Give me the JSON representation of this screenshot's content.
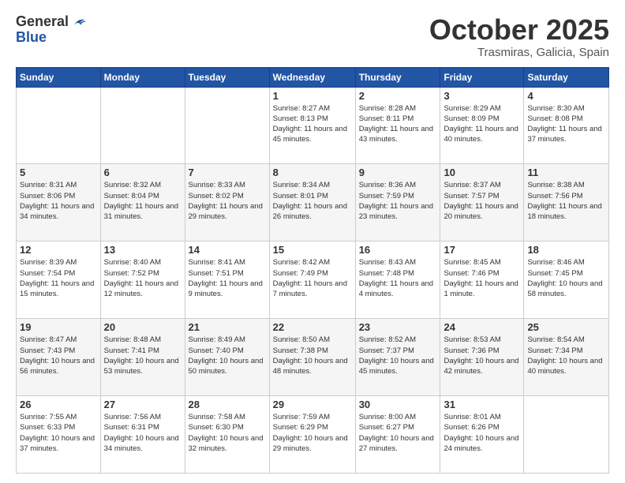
{
  "header": {
    "logo_general": "General",
    "logo_blue": "Blue",
    "month": "October 2025",
    "location": "Trasmiras, Galicia, Spain"
  },
  "weekdays": [
    "Sunday",
    "Monday",
    "Tuesday",
    "Wednesday",
    "Thursday",
    "Friday",
    "Saturday"
  ],
  "weeks": [
    [
      {
        "day": "",
        "info": ""
      },
      {
        "day": "",
        "info": ""
      },
      {
        "day": "",
        "info": ""
      },
      {
        "day": "1",
        "info": "Sunrise: 8:27 AM\nSunset: 8:13 PM\nDaylight: 11 hours\nand 45 minutes."
      },
      {
        "day": "2",
        "info": "Sunrise: 8:28 AM\nSunset: 8:11 PM\nDaylight: 11 hours\nand 43 minutes."
      },
      {
        "day": "3",
        "info": "Sunrise: 8:29 AM\nSunset: 8:09 PM\nDaylight: 11 hours\nand 40 minutes."
      },
      {
        "day": "4",
        "info": "Sunrise: 8:30 AM\nSunset: 8:08 PM\nDaylight: 11 hours\nand 37 minutes."
      }
    ],
    [
      {
        "day": "5",
        "info": "Sunrise: 8:31 AM\nSunset: 8:06 PM\nDaylight: 11 hours\nand 34 minutes."
      },
      {
        "day": "6",
        "info": "Sunrise: 8:32 AM\nSunset: 8:04 PM\nDaylight: 11 hours\nand 31 minutes."
      },
      {
        "day": "7",
        "info": "Sunrise: 8:33 AM\nSunset: 8:02 PM\nDaylight: 11 hours\nand 29 minutes."
      },
      {
        "day": "8",
        "info": "Sunrise: 8:34 AM\nSunset: 8:01 PM\nDaylight: 11 hours\nand 26 minutes."
      },
      {
        "day": "9",
        "info": "Sunrise: 8:36 AM\nSunset: 7:59 PM\nDaylight: 11 hours\nand 23 minutes."
      },
      {
        "day": "10",
        "info": "Sunrise: 8:37 AM\nSunset: 7:57 PM\nDaylight: 11 hours\nand 20 minutes."
      },
      {
        "day": "11",
        "info": "Sunrise: 8:38 AM\nSunset: 7:56 PM\nDaylight: 11 hours\nand 18 minutes."
      }
    ],
    [
      {
        "day": "12",
        "info": "Sunrise: 8:39 AM\nSunset: 7:54 PM\nDaylight: 11 hours\nand 15 minutes."
      },
      {
        "day": "13",
        "info": "Sunrise: 8:40 AM\nSunset: 7:52 PM\nDaylight: 11 hours\nand 12 minutes."
      },
      {
        "day": "14",
        "info": "Sunrise: 8:41 AM\nSunset: 7:51 PM\nDaylight: 11 hours\nand 9 minutes."
      },
      {
        "day": "15",
        "info": "Sunrise: 8:42 AM\nSunset: 7:49 PM\nDaylight: 11 hours\nand 7 minutes."
      },
      {
        "day": "16",
        "info": "Sunrise: 8:43 AM\nSunset: 7:48 PM\nDaylight: 11 hours\nand 4 minutes."
      },
      {
        "day": "17",
        "info": "Sunrise: 8:45 AM\nSunset: 7:46 PM\nDaylight: 11 hours\nand 1 minute."
      },
      {
        "day": "18",
        "info": "Sunrise: 8:46 AM\nSunset: 7:45 PM\nDaylight: 10 hours\nand 58 minutes."
      }
    ],
    [
      {
        "day": "19",
        "info": "Sunrise: 8:47 AM\nSunset: 7:43 PM\nDaylight: 10 hours\nand 56 minutes."
      },
      {
        "day": "20",
        "info": "Sunrise: 8:48 AM\nSunset: 7:41 PM\nDaylight: 10 hours\nand 53 minutes."
      },
      {
        "day": "21",
        "info": "Sunrise: 8:49 AM\nSunset: 7:40 PM\nDaylight: 10 hours\nand 50 minutes."
      },
      {
        "day": "22",
        "info": "Sunrise: 8:50 AM\nSunset: 7:38 PM\nDaylight: 10 hours\nand 48 minutes."
      },
      {
        "day": "23",
        "info": "Sunrise: 8:52 AM\nSunset: 7:37 PM\nDaylight: 10 hours\nand 45 minutes."
      },
      {
        "day": "24",
        "info": "Sunrise: 8:53 AM\nSunset: 7:36 PM\nDaylight: 10 hours\nand 42 minutes."
      },
      {
        "day": "25",
        "info": "Sunrise: 8:54 AM\nSunset: 7:34 PM\nDaylight: 10 hours\nand 40 minutes."
      }
    ],
    [
      {
        "day": "26",
        "info": "Sunrise: 7:55 AM\nSunset: 6:33 PM\nDaylight: 10 hours\nand 37 minutes."
      },
      {
        "day": "27",
        "info": "Sunrise: 7:56 AM\nSunset: 6:31 PM\nDaylight: 10 hours\nand 34 minutes."
      },
      {
        "day": "28",
        "info": "Sunrise: 7:58 AM\nSunset: 6:30 PM\nDaylight: 10 hours\nand 32 minutes."
      },
      {
        "day": "29",
        "info": "Sunrise: 7:59 AM\nSunset: 6:29 PM\nDaylight: 10 hours\nand 29 minutes."
      },
      {
        "day": "30",
        "info": "Sunrise: 8:00 AM\nSunset: 6:27 PM\nDaylight: 10 hours\nand 27 minutes."
      },
      {
        "day": "31",
        "info": "Sunrise: 8:01 AM\nSunset: 6:26 PM\nDaylight: 10 hours\nand 24 minutes."
      },
      {
        "day": "",
        "info": ""
      }
    ]
  ]
}
